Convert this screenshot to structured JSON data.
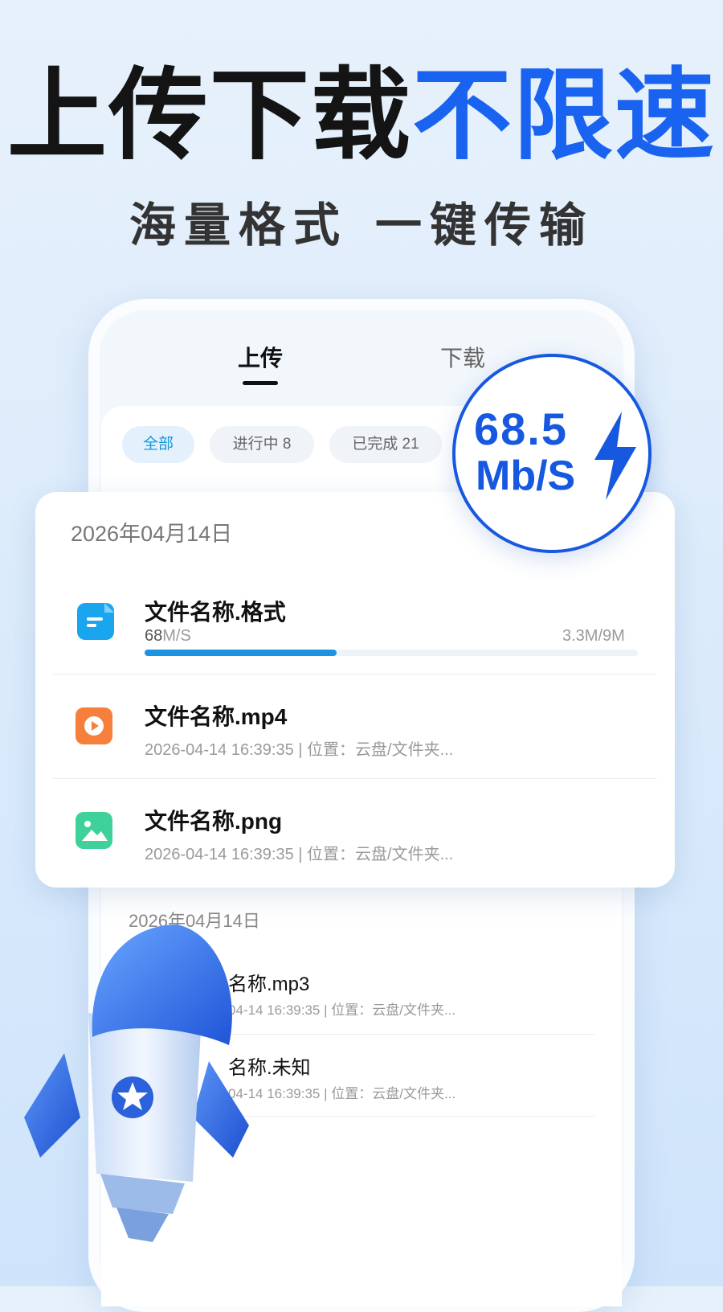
{
  "headline": {
    "part1": "上传下载",
    "part2": "不限速"
  },
  "subtitle": {
    "part1": "海量格式",
    "part2": "一键传输"
  },
  "tabs": [
    {
      "label": "上传"
    },
    {
      "label": "下载"
    }
  ],
  "chips": [
    {
      "label": "全部"
    },
    {
      "label": "进行中 8"
    },
    {
      "label": "已完成 21"
    }
  ],
  "speed_badge": {
    "value": "68.5",
    "unit": "Mb/S"
  },
  "card": {
    "date": "2026年04月14日",
    "items": [
      {
        "name": "文件名称.格式",
        "speed_num": "68",
        "speed_unit": "M/S",
        "size": "3.3M/9M",
        "progress": 0.39,
        "icon": "document-icon",
        "color": "#1aa6ee"
      },
      {
        "name": "文件名称.mp4",
        "meta": "2026-04-14 16:39:35 | 位置：云盘/文件夹...",
        "icon": "video-play-icon",
        "color": "#f57f3b"
      },
      {
        "name": "文件名称.png",
        "meta": "2026-04-14 16:39:35 | 位置：云盘/文件夹...",
        "icon": "image-icon",
        "color": "#3fd19a"
      }
    ]
  },
  "lower_list": {
    "date": "2026年04月14日",
    "items": [
      {
        "name": "名称.mp3",
        "meta": "04-14 16:39:35 | 位置：云盘/文件夹..."
      },
      {
        "name": "名称.未知",
        "meta": "04-14 16:39:35 | 位置：云盘/文件夹..."
      }
    ]
  },
  "colors": {
    "accent_blue": "#1a63f0",
    "progress": "#1b93e3",
    "badge": "#1658e0"
  }
}
